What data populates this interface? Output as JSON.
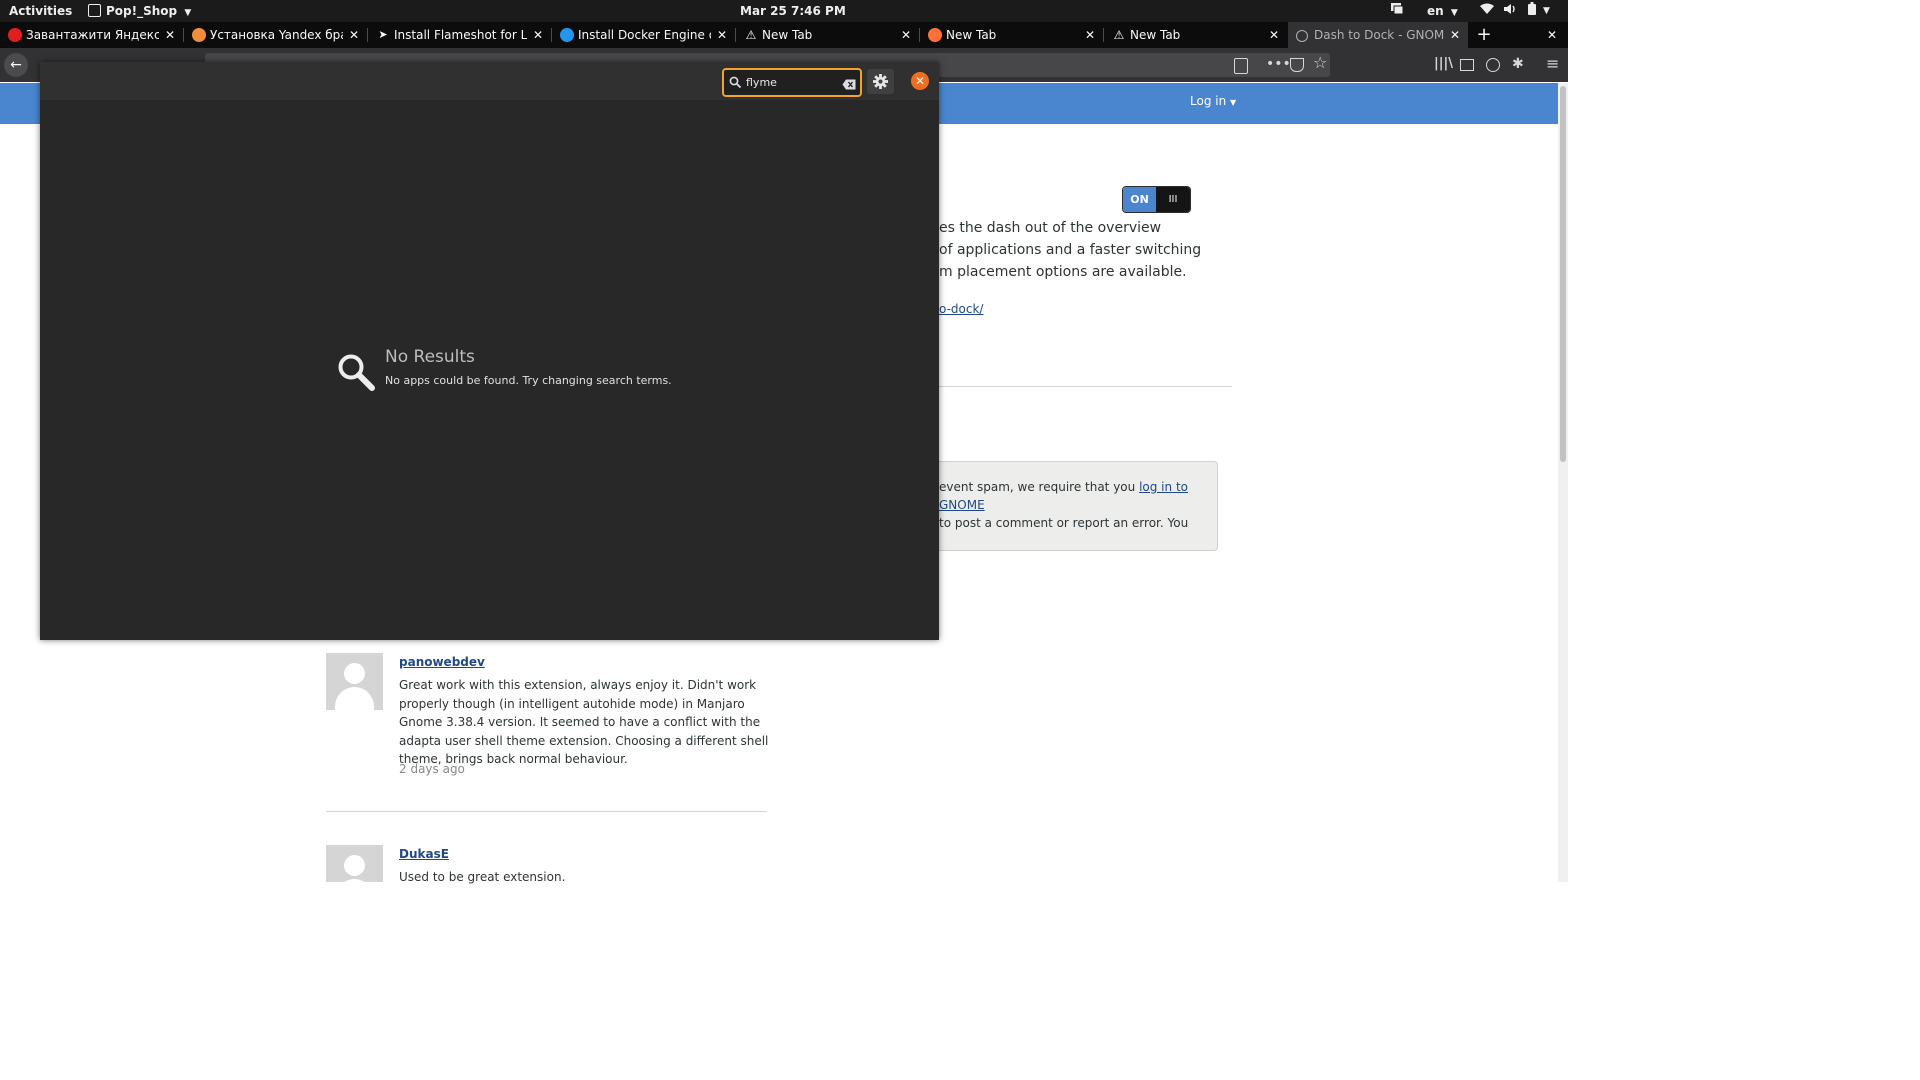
{
  "topbar": {
    "activities": "Activities",
    "app_menu": "Pop!_Shop",
    "clock": "Mar 25   7:46 PM",
    "keyboard_layout": "en"
  },
  "browser": {
    "tabs": [
      {
        "title": "Завантажити Яндекс.Брау",
        "favicon_color": "#e02020"
      },
      {
        "title": "Установка Yandex браузер",
        "favicon_color": "#f08c3a"
      },
      {
        "title": "Install Flameshot for Linux",
        "favicon_color": "#ffffff"
      },
      {
        "title": "Install Docker Engine on U",
        "favicon_color": "#2496ed"
      },
      {
        "title": "New Tab",
        "favicon_color": "#ffffff"
      },
      {
        "title": "New Tab",
        "favicon_color": "#ff7139"
      },
      {
        "title": "New Tab",
        "favicon_color": "#ffffff"
      },
      {
        "title": "Dash to Dock - GNOME She",
        "favicon_color": "#b1b1b3",
        "active": true
      }
    ]
  },
  "page": {
    "login": "Log in",
    "toggle_on": "ON",
    "toggle_off": "III",
    "description_lines": [
      "es the dash out of the overview",
      "of applications and a faster switching",
      "m placement options are available."
    ],
    "homepage_link": "o-dock/",
    "notice_prefix": "event spam, we require that you ",
    "notice_link": "log in to GNOME",
    "notice_suffix": "to post a comment or report an error. You",
    "comments": [
      {
        "author": "panowebdev",
        "text": "Great work with this extension, always enjoy it. Didn't work properly though (in intelligent autohide mode) in Manjaro Gnome 3.38.4 version. It seemed to have a conflict with the adapta user shell theme extension. Choosing a different shell theme, brings back normal behaviour.",
        "date": "2 days ago"
      },
      {
        "author": "DukasE",
        "text": "Used to be great extension."
      }
    ]
  },
  "shop": {
    "search_value": "flyme",
    "no_results_title": "No Results",
    "no_results_desc": "No apps could be found. Try changing search terms.",
    "accent_color": "#f3a32b",
    "close_color": "#f06e22"
  }
}
